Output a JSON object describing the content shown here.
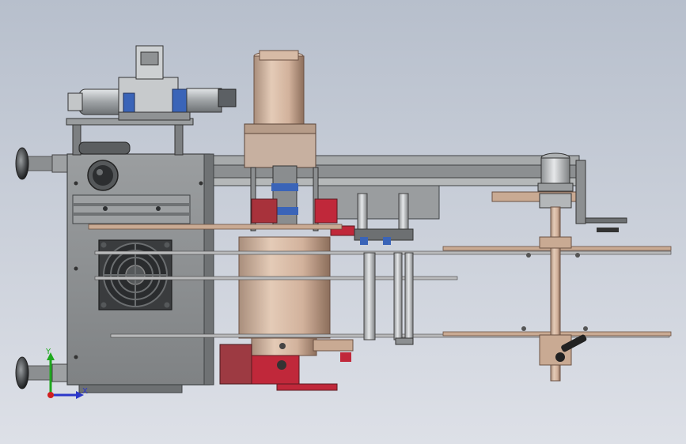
{
  "viewport": {
    "background_top": "#b7bfcc",
    "background_bottom": "#dde0e7"
  },
  "model": {
    "colors": {
      "plate_steel": "#8f9294",
      "plate_steel_dark": "#5d6062",
      "rail_steel": "#a7aaab",
      "copper_tan": "#c9aa93",
      "copper_tan_dark": "#8c6e5b",
      "rod_silver": "#c3c6c8",
      "fan_dark": "#3a3c3e",
      "valve_blue": "#3a64b8",
      "accent_red": "#c0283a",
      "handle_black": "#222222"
    }
  },
  "triad": {
    "y_label": "Y",
    "x_label": "X",
    "y_color": "#1fa81f",
    "x_color": "#2b37c9",
    "z_color": "#d01f1f"
  }
}
